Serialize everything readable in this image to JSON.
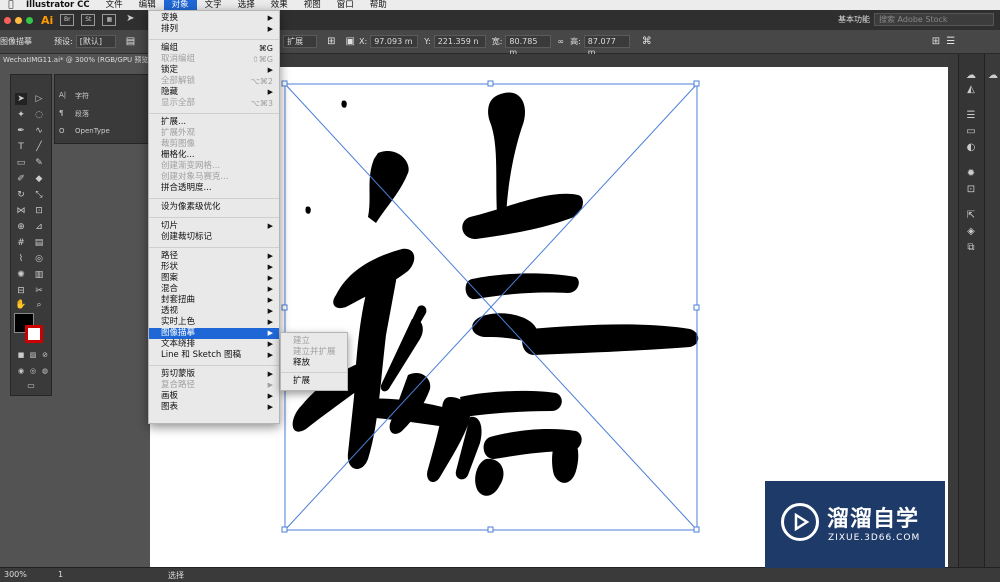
{
  "menubar": {
    "app_name": "Illustrator CC",
    "items": [
      "文件",
      "编辑",
      "对象",
      "文字",
      "选择",
      "效果",
      "视图",
      "窗口",
      "帮助"
    ],
    "active": "对象"
  },
  "appbar": {
    "logo": "Ai",
    "app_icons": [
      "Br",
      "St"
    ],
    "workspace": "基本功能",
    "stock_search_placeholder": "搜索 Adobe Stock"
  },
  "control_bar": {
    "mode_label": "图像描摹",
    "preset_label": "预设:",
    "preset_value": "[默认]",
    "expand_field": "扩展",
    "x_label": "X:",
    "x_value": "97.093 m",
    "y_label": "Y:",
    "y_value": "221.359 n",
    "w_label": "宽:",
    "w_value": "80.785 m",
    "h_label": "高:",
    "h_value": "87.077 m"
  },
  "document": {
    "tab_title": "WechatIMG11.ai* @ 300% (RGB/GPU 预览)"
  },
  "char_panel": {
    "char_label": "字符",
    "para_label": "段落",
    "opentype_label": "OpenType"
  },
  "object_menu": {
    "items": [
      {
        "label": "变换",
        "kind": "submenu"
      },
      {
        "label": "排列",
        "kind": "submenu"
      },
      {
        "label": "编组",
        "shortcut": "⌘G"
      },
      {
        "label": "取消编组",
        "shortcut": "⇧⌘G",
        "disabled": true
      },
      {
        "label": "锁定",
        "kind": "submenu"
      },
      {
        "label": "全部解锁",
        "shortcut": "⌥⌘2",
        "disabled": true
      },
      {
        "label": "隐藏",
        "kind": "submenu"
      },
      {
        "label": "显示全部",
        "shortcut": "⌥⌘3",
        "disabled": true
      },
      {
        "label": "扩展..."
      },
      {
        "label": "扩展外观",
        "disabled": true
      },
      {
        "label": "裁剪图像",
        "disabled": true
      },
      {
        "label": "栅格化..."
      },
      {
        "label": "创建渐变网格...",
        "disabled": true
      },
      {
        "label": "创建对象马赛克...",
        "disabled": true
      },
      {
        "label": "拼合透明度..."
      },
      {
        "label": "设为像素级优化"
      },
      {
        "label": "切片",
        "kind": "submenu"
      },
      {
        "label": "创建裁切标记"
      },
      {
        "label": "路径",
        "kind": "submenu"
      },
      {
        "label": "形状",
        "kind": "submenu"
      },
      {
        "label": "图案",
        "kind": "submenu"
      },
      {
        "label": "混合",
        "kind": "submenu"
      },
      {
        "label": "封套扭曲",
        "kind": "submenu"
      },
      {
        "label": "透视",
        "kind": "submenu"
      },
      {
        "label": "实时上色",
        "kind": "submenu"
      },
      {
        "label": "图像描摹",
        "kind": "submenu",
        "highlighted": true
      },
      {
        "label": "文本绕排",
        "kind": "submenu"
      },
      {
        "label": "Line 和 Sketch 图稿",
        "kind": "submenu"
      },
      {
        "label": "剪切蒙版",
        "kind": "submenu"
      },
      {
        "label": "复合路径",
        "kind": "submenu",
        "disabled": true
      },
      {
        "label": "画板",
        "kind": "submenu"
      },
      {
        "label": "图表",
        "kind": "submenu"
      }
    ]
  },
  "trace_submenu": {
    "items": [
      {
        "label": "建立",
        "disabled": true
      },
      {
        "label": "建立并扩展",
        "disabled": true
      },
      {
        "label": "释放"
      },
      {
        "label": "扩展"
      }
    ]
  },
  "status_bar": {
    "zoom": "300%",
    "artboard_num": "1",
    "tool_name": "选择"
  },
  "watermark": {
    "title": "溜溜自学",
    "url": "ZIXUE.3D66.COM"
  },
  "colors": {
    "menu_highlight": "#1f67d6",
    "selection_blue": "#4a7fd8",
    "watermark_bg": "#1e3a68"
  }
}
